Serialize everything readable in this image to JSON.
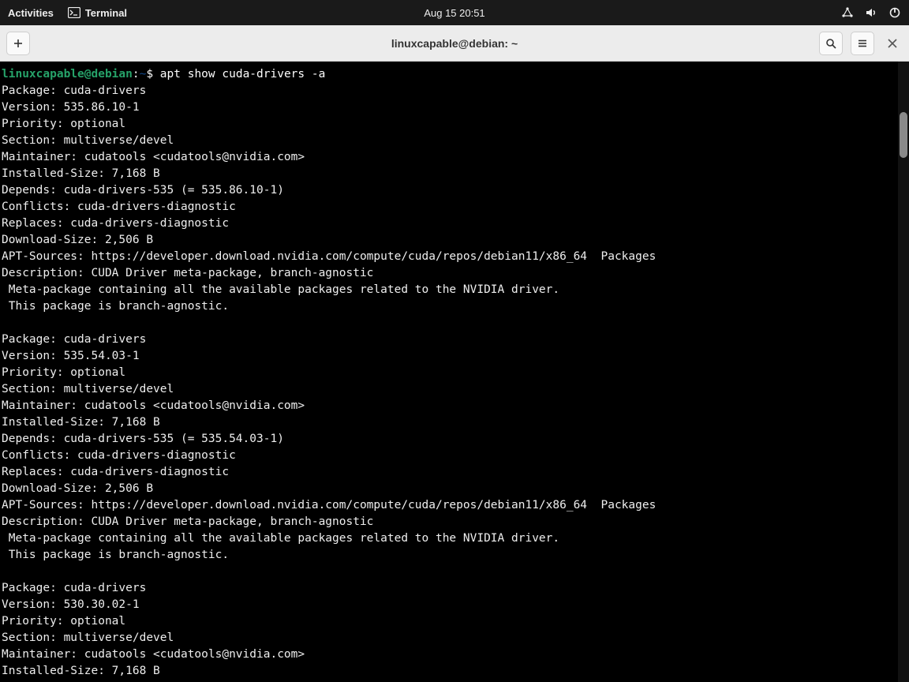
{
  "topbar": {
    "activities": "Activities",
    "terminal_label": "Terminal",
    "datetime": "Aug 15  20:51"
  },
  "window": {
    "title": "linuxcapable@debian: ~"
  },
  "prompt": {
    "userhost": "linuxcapable@debian",
    "sep": ":",
    "path": "~",
    "dollar": "$",
    "command": " apt show cuda-drivers -a"
  },
  "packages": [
    {
      "Package": "cuda-drivers",
      "Version": "535.86.10-1",
      "Priority": "optional",
      "Section": "multiverse/devel",
      "Maintainer": "cudatools <cudatools@nvidia.com>",
      "InstalledSize": "7,168 B",
      "Depends": "cuda-drivers-535 (= 535.86.10-1)",
      "Conflicts": "cuda-drivers-diagnostic",
      "Replaces": "cuda-drivers-diagnostic",
      "DownloadSize": "2,506 B",
      "APTSources": "https://developer.download.nvidia.com/compute/cuda/repos/debian11/x86_64  Packages",
      "Description": "CUDA Driver meta-package, branch-agnostic",
      "DescLine1": " Meta-package containing all the available packages related to the NVIDIA driver.",
      "DescLine2": " This package is branch-agnostic."
    },
    {
      "Package": "cuda-drivers",
      "Version": "535.54.03-1",
      "Priority": "optional",
      "Section": "multiverse/devel",
      "Maintainer": "cudatools <cudatools@nvidia.com>",
      "InstalledSize": "7,168 B",
      "Depends": "cuda-drivers-535 (= 535.54.03-1)",
      "Conflicts": "cuda-drivers-diagnostic",
      "Replaces": "cuda-drivers-diagnostic",
      "DownloadSize": "2,506 B",
      "APTSources": "https://developer.download.nvidia.com/compute/cuda/repos/debian11/x86_64  Packages",
      "Description": "CUDA Driver meta-package, branch-agnostic",
      "DescLine1": " Meta-package containing all the available packages related to the NVIDIA driver.",
      "DescLine2": " This package is branch-agnostic."
    },
    {
      "Package": "cuda-drivers",
      "Version": "530.30.02-1",
      "Priority": "optional",
      "Section": "multiverse/devel",
      "Maintainer": "cudatools <cudatools@nvidia.com>",
      "InstalledSize": "7,168 B"
    }
  ],
  "labels": {
    "Package": "Package: ",
    "Version": "Version: ",
    "Priority": "Priority: ",
    "Section": "Section: ",
    "Maintainer": "Maintainer: ",
    "InstalledSize": "Installed-Size: ",
    "Depends": "Depends: ",
    "Conflicts": "Conflicts: ",
    "Replaces": "Replaces: ",
    "DownloadSize": "Download-Size: ",
    "APTSources": "APT-Sources: ",
    "Description": "Description: "
  }
}
